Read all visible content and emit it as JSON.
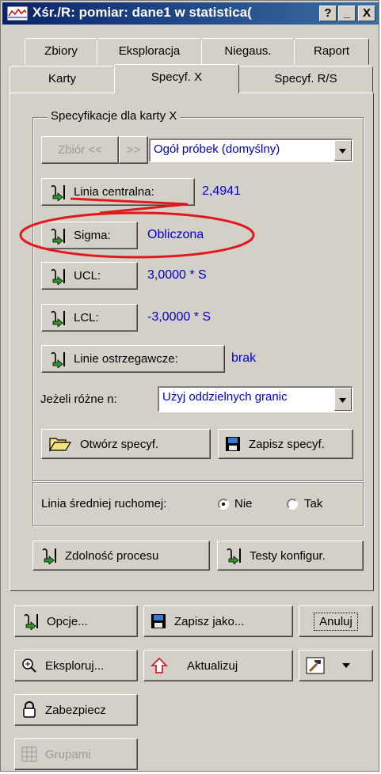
{
  "window": {
    "title": "Xśr./R: pomiar: dane1 w statistica(",
    "help": "?",
    "minimize": "_",
    "close": "X"
  },
  "tabs_row1": [
    "Zbiory",
    "Eksploracja",
    "Niegaus.",
    "Raport"
  ],
  "tabs_row2": [
    "Karty",
    "Specyf. X",
    "Specyf. R/S"
  ],
  "active_tab": "Specyf. X",
  "spec_group": {
    "legend": "Specyfikacje dla karty X",
    "zbior_btn": "Zbiór <<",
    "next_btn": ">>",
    "sample_select": "Ogół próbek (domyślny)",
    "center_btn": "Linia centralna:",
    "center_val": "2,4941",
    "sigma_btn": "Sigma:",
    "sigma_val": "Obliczona",
    "ucl_btn": "UCL:",
    "ucl_val": "3,0000 * S",
    "lcl_btn": "LCL:",
    "lcl_val": "-3,0000 * S",
    "warn_btn": "Linie ostrzegawcze:",
    "warn_val": "brak",
    "n_label": "Jeżeli różne n:",
    "n_select": "Użyj oddzielnych granic",
    "open_btn": "Otwórz specyf.",
    "save_btn": "Zapisz specyf."
  },
  "moving_avg": {
    "label": "Linia średniej ruchomej:",
    "opt_no": "Nie",
    "opt_yes": "Tak",
    "selected": "Nie"
  },
  "capability_btn": "Zdolność procesu",
  "tests_btn": "Testy konfigur.",
  "bottom": {
    "options_btn": "Opcje...",
    "saveas_btn": "Zapisz jako...",
    "cancel_btn": "Anuluj",
    "explore_btn": "Eksploruj...",
    "update_btn": "Aktualizuj",
    "lock_btn": "Zabezpiecz",
    "groups_btn": "Grupami"
  },
  "colors": {
    "annotation": "#e0191d",
    "value_blue": "#0000cc",
    "face": "#d4d0c8"
  }
}
